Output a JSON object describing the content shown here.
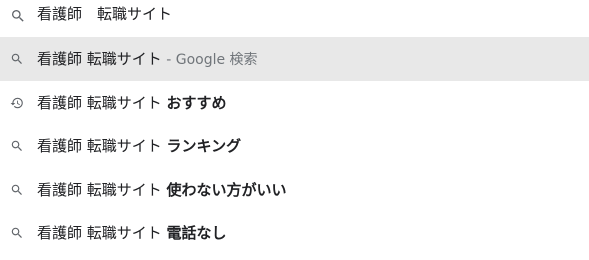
{
  "search": {
    "value": "看護師　転職サイト",
    "icon": "search-icon"
  },
  "suggestions": [
    {
      "icon": "search-icon",
      "query": "看護師 転職サイト",
      "suffix": "",
      "hint": " - Google 検索",
      "selected": true
    },
    {
      "icon": "history-icon",
      "query": "看護師 転職サイト ",
      "suffix": "おすすめ",
      "hint": "",
      "selected": false
    },
    {
      "icon": "search-icon",
      "query": "看護師 転職サイト ",
      "suffix": "ランキング",
      "hint": "",
      "selected": false
    },
    {
      "icon": "search-icon",
      "query": "看護師 転職サイト ",
      "suffix": "使わない方がいい",
      "hint": "",
      "selected": false
    },
    {
      "icon": "search-icon",
      "query": "看護師 転職サイト ",
      "suffix": "電話なし",
      "hint": "",
      "selected": false
    }
  ],
  "colors": {
    "selected_row": "#e8e8e8",
    "icon": "#5f6368",
    "hint": "#70757a"
  }
}
